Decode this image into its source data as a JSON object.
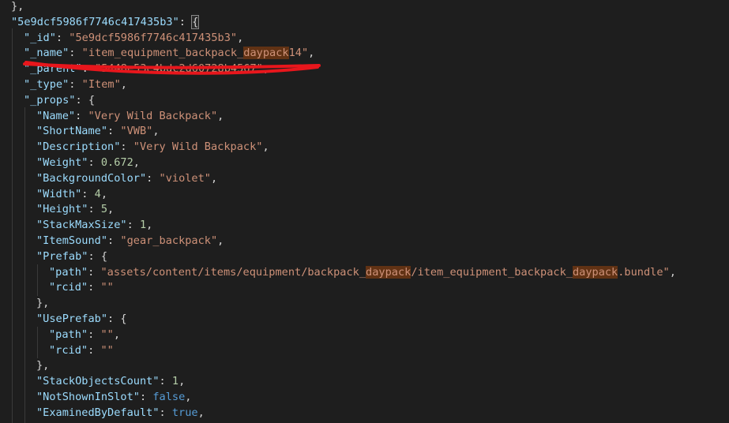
{
  "editor": {
    "lines": [
      {
        "indent": 0,
        "tokens": [
          {
            "t": "p",
            "v": "},"
          }
        ]
      },
      {
        "indent": 0,
        "tokens": [
          {
            "t": "k",
            "v": "\"5e9dcf5986f7746c417435b3\""
          },
          {
            "t": "p",
            "v": ": "
          },
          {
            "t": "p",
            "v": "{",
            "bm": true
          }
        ]
      },
      {
        "indent": 1,
        "tokens": [
          {
            "t": "k",
            "v": "\"_id\""
          },
          {
            "t": "p",
            "v": ": "
          },
          {
            "t": "s",
            "v": "\"5e9dcf5986f7746c417435b3\""
          },
          {
            "t": "p",
            "v": ","
          }
        ]
      },
      {
        "indent": 1,
        "tokens": [
          {
            "t": "k",
            "v": "\"_name\""
          },
          {
            "t": "p",
            "v": ": "
          },
          {
            "t": "s",
            "v": "\"item_equipment_backpack_"
          },
          {
            "t": "s",
            "v": "daypack",
            "hl": true
          },
          {
            "t": "s",
            "v": "14\""
          },
          {
            "t": "p",
            "v": ","
          }
        ]
      },
      {
        "indent": 1,
        "tokens": [
          {
            "t": "k",
            "v": "\"_parent\""
          },
          {
            "t": "p",
            "v": ": "
          },
          {
            "t": "s",
            "v": "\"5448e53e4bdc2d60728b4567\""
          },
          {
            "t": "p",
            "v": ","
          }
        ]
      },
      {
        "indent": 1,
        "tokens": [
          {
            "t": "k",
            "v": "\"_type\""
          },
          {
            "t": "p",
            "v": ": "
          },
          {
            "t": "s",
            "v": "\"Item\""
          },
          {
            "t": "p",
            "v": ","
          }
        ]
      },
      {
        "indent": 1,
        "tokens": [
          {
            "t": "k",
            "v": "\"_props\""
          },
          {
            "t": "p",
            "v": ": {"
          }
        ]
      },
      {
        "indent": 2,
        "tokens": [
          {
            "t": "k",
            "v": "\"Name\""
          },
          {
            "t": "p",
            "v": ": "
          },
          {
            "t": "s",
            "v": "\"Very Wild Backpack\""
          },
          {
            "t": "p",
            "v": ","
          }
        ]
      },
      {
        "indent": 2,
        "tokens": [
          {
            "t": "k",
            "v": "\"ShortName\""
          },
          {
            "t": "p",
            "v": ": "
          },
          {
            "t": "s",
            "v": "\"VWB\""
          },
          {
            "t": "p",
            "v": ","
          }
        ]
      },
      {
        "indent": 2,
        "tokens": [
          {
            "t": "k",
            "v": "\"Description\""
          },
          {
            "t": "p",
            "v": ": "
          },
          {
            "t": "s",
            "v": "\"Very Wild Backpack\""
          },
          {
            "t": "p",
            "v": ","
          }
        ]
      },
      {
        "indent": 2,
        "tokens": [
          {
            "t": "k",
            "v": "\"Weight\""
          },
          {
            "t": "p",
            "v": ": "
          },
          {
            "t": "n",
            "v": "0.672"
          },
          {
            "t": "p",
            "v": ","
          }
        ]
      },
      {
        "indent": 2,
        "tokens": [
          {
            "t": "k",
            "v": "\"BackgroundColor\""
          },
          {
            "t": "p",
            "v": ": "
          },
          {
            "t": "s",
            "v": "\"violet\""
          },
          {
            "t": "p",
            "v": ","
          }
        ]
      },
      {
        "indent": 2,
        "tokens": [
          {
            "t": "k",
            "v": "\"Width\""
          },
          {
            "t": "p",
            "v": ": "
          },
          {
            "t": "n",
            "v": "4"
          },
          {
            "t": "p",
            "v": ","
          }
        ]
      },
      {
        "indent": 2,
        "tokens": [
          {
            "t": "k",
            "v": "\"Height\""
          },
          {
            "t": "p",
            "v": ": "
          },
          {
            "t": "n",
            "v": "5"
          },
          {
            "t": "p",
            "v": ","
          }
        ]
      },
      {
        "indent": 2,
        "tokens": [
          {
            "t": "k",
            "v": "\"StackMaxSize\""
          },
          {
            "t": "p",
            "v": ": "
          },
          {
            "t": "n",
            "v": "1"
          },
          {
            "t": "p",
            "v": ","
          }
        ]
      },
      {
        "indent": 2,
        "tokens": [
          {
            "t": "k",
            "v": "\"ItemSound\""
          },
          {
            "t": "p",
            "v": ": "
          },
          {
            "t": "s",
            "v": "\"gear_backpack\""
          },
          {
            "t": "p",
            "v": ","
          }
        ]
      },
      {
        "indent": 2,
        "tokens": [
          {
            "t": "k",
            "v": "\"Prefab\""
          },
          {
            "t": "p",
            "v": ": {"
          }
        ]
      },
      {
        "indent": 3,
        "tokens": [
          {
            "t": "k",
            "v": "\"path\""
          },
          {
            "t": "p",
            "v": ": "
          },
          {
            "t": "s",
            "v": "\"assets/content/items/equipment/backpack_"
          },
          {
            "t": "s",
            "v": "daypack",
            "hl": true
          },
          {
            "t": "s",
            "v": "/item_equipment_backpack_"
          },
          {
            "t": "s",
            "v": "daypack",
            "hl": true
          },
          {
            "t": "s",
            "v": ".bundle\""
          },
          {
            "t": "p",
            "v": ","
          }
        ]
      },
      {
        "indent": 3,
        "tokens": [
          {
            "t": "k",
            "v": "\"rcid\""
          },
          {
            "t": "p",
            "v": ": "
          },
          {
            "t": "s",
            "v": "\"\""
          }
        ]
      },
      {
        "indent": 2,
        "tokens": [
          {
            "t": "p",
            "v": "},"
          }
        ]
      },
      {
        "indent": 2,
        "tokens": [
          {
            "t": "k",
            "v": "\"UsePrefab\""
          },
          {
            "t": "p",
            "v": ": {"
          }
        ]
      },
      {
        "indent": 3,
        "tokens": [
          {
            "t": "k",
            "v": "\"path\""
          },
          {
            "t": "p",
            "v": ": "
          },
          {
            "t": "s",
            "v": "\"\""
          },
          {
            "t": "p",
            "v": ","
          }
        ]
      },
      {
        "indent": 3,
        "tokens": [
          {
            "t": "k",
            "v": "\"rcid\""
          },
          {
            "t": "p",
            "v": ": "
          },
          {
            "t": "s",
            "v": "\"\""
          }
        ]
      },
      {
        "indent": 2,
        "tokens": [
          {
            "t": "p",
            "v": "},"
          }
        ]
      },
      {
        "indent": 2,
        "tokens": [
          {
            "t": "k",
            "v": "\"StackObjectsCount\""
          },
          {
            "t": "p",
            "v": ": "
          },
          {
            "t": "n",
            "v": "1"
          },
          {
            "t": "p",
            "v": ","
          }
        ]
      },
      {
        "indent": 2,
        "tokens": [
          {
            "t": "k",
            "v": "\"NotShownInSlot\""
          },
          {
            "t": "p",
            "v": ": "
          },
          {
            "t": "b",
            "v": "false"
          },
          {
            "t": "p",
            "v": ","
          }
        ]
      },
      {
        "indent": 2,
        "tokens": [
          {
            "t": "k",
            "v": "\"ExaminedByDefault\""
          },
          {
            "t": "p",
            "v": ": "
          },
          {
            "t": "b",
            "v": "true"
          },
          {
            "t": "p",
            "v": ","
          }
        ]
      }
    ]
  },
  "colors": {
    "background": "#1e1e1e",
    "key": "#9cdcfe",
    "string": "#ce9178",
    "number": "#b5cea8",
    "boolean": "#569cd6",
    "punctuation": "#d4d4d4",
    "find_highlight": "#613214",
    "annotation_stroke": "#e8161c"
  }
}
